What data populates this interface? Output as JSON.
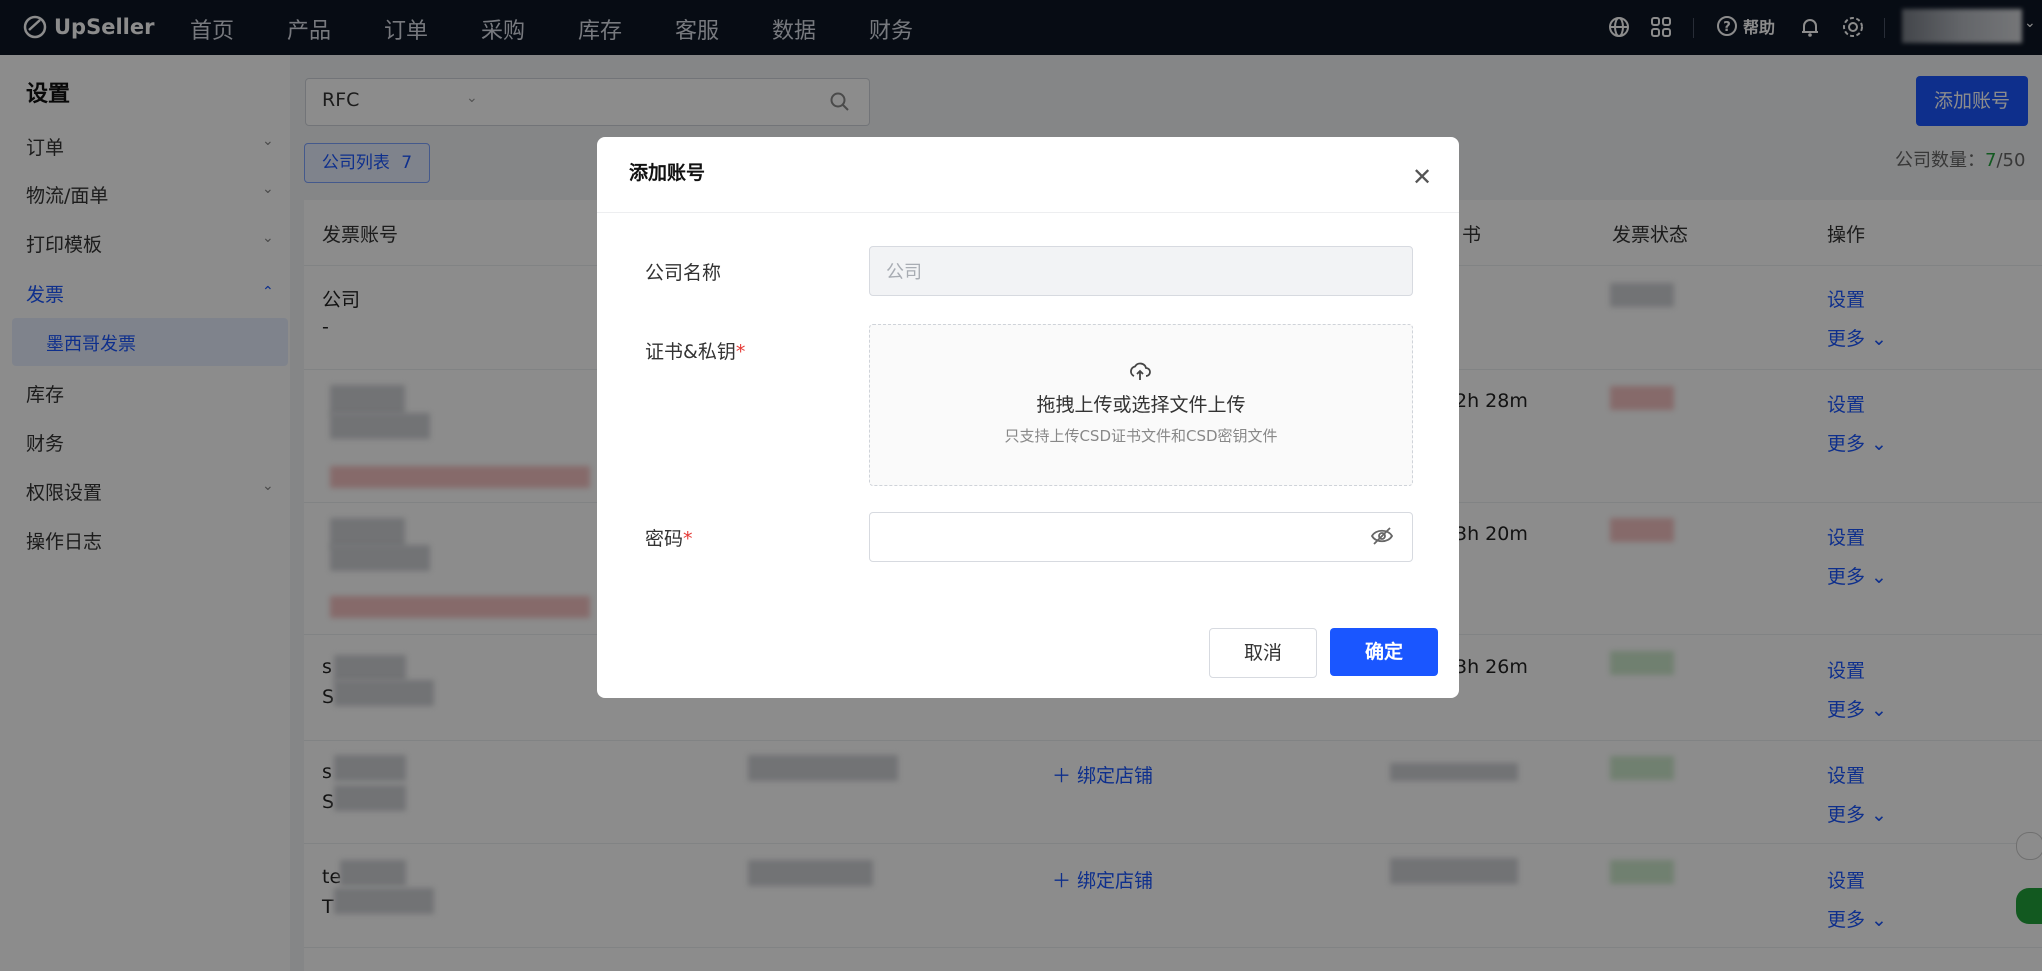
{
  "topnav": {
    "logo": "UpSeller",
    "items": [
      "首页",
      "产品",
      "订单",
      "采购",
      "库存",
      "客服",
      "数据",
      "财务"
    ],
    "help_label": "帮助"
  },
  "sidebar": {
    "title": "设置",
    "items": [
      {
        "label": "订单"
      },
      {
        "label": "物流/面单"
      },
      {
        "label": "打印模板"
      },
      {
        "label": "发票"
      },
      {
        "label": "墨西哥发票"
      },
      {
        "label": "库存"
      },
      {
        "label": "财务"
      },
      {
        "label": "权限设置"
      },
      {
        "label": "操作日志"
      }
    ]
  },
  "search": {
    "select_value": "RFC"
  },
  "tabs": {
    "company_list": "公司列表",
    "count": "7"
  },
  "header_actions": {
    "add_account": "添加账号",
    "company_count_label": "公司数量：",
    "company_count_current": "7",
    "company_count_total": "/50"
  },
  "table": {
    "headers": [
      "发票账号",
      "书",
      "发票状态",
      "操作"
    ],
    "row1": {
      "name": "公司",
      "sub": "-"
    },
    "times": [
      "2h 28m",
      "3h 20m",
      "3h 26m"
    ],
    "bind_store": "绑定店铺",
    "settings": "设置",
    "more": "更多",
    "row_prefixes": [
      "s",
      "S",
      "s",
      "S",
      "te",
      "T"
    ]
  },
  "modal": {
    "title": "添加账号",
    "company_name_label": "公司名称",
    "company_name_placeholder": "公司",
    "cert_label": "证书&私钥",
    "dropzone_text": "拖拽上传或选择文件上传",
    "dropzone_hint": "只支持上传CSD证书文件和CSD密钥文件",
    "password_label": "密码",
    "cancel": "取消",
    "confirm": "确定"
  },
  "colors": {
    "primary": "#1a56ff",
    "nav_bg": "#0e1726",
    "required": "#e53935"
  }
}
